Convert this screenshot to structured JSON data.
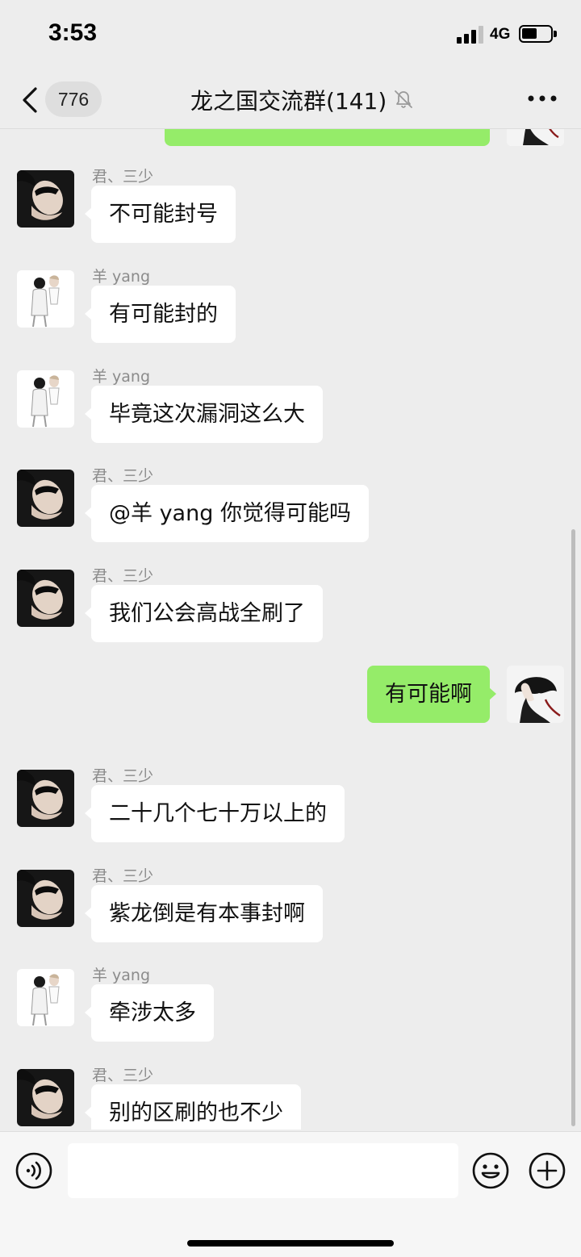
{
  "status_bar": {
    "time": "3:53",
    "network": "4G",
    "signal_bars_active": 3,
    "signal_bars_total": 4,
    "battery_level": 0.55
  },
  "nav": {
    "unread_count": "776",
    "title": "龙之国交流群(141)",
    "muted": true,
    "back_icon": "chevron-left-icon",
    "mute_icon": "bell-off-icon",
    "more_icon": "ellipsis-icon"
  },
  "messages": [
    {
      "sender": "君、三少",
      "text": "不可能封号",
      "direction": "incoming",
      "avatar": "avatar-junsanshao"
    },
    {
      "sender": "羊 yang",
      "text": "有可能封的",
      "direction": "incoming",
      "avatar": "avatar-yang"
    },
    {
      "sender": "羊 yang",
      "text": "毕竟这次漏洞这么大",
      "direction": "incoming",
      "avatar": "avatar-yang"
    },
    {
      "sender": "君、三少",
      "text": "@羊 yang 你觉得可能吗",
      "direction": "incoming",
      "avatar": "avatar-junsanshao"
    },
    {
      "sender": "君、三少",
      "text": "我们公会高战全刷了",
      "direction": "incoming",
      "avatar": "avatar-junsanshao"
    },
    {
      "sender": "",
      "text": "有可能啊",
      "direction": "outgoing",
      "avatar": "avatar-self"
    },
    {
      "sender": "君、三少",
      "text": "二十几个七十万以上的",
      "direction": "incoming",
      "avatar": "avatar-junsanshao"
    },
    {
      "sender": "君、三少",
      "text": "紫龙倒是有本事封啊",
      "direction": "incoming",
      "avatar": "avatar-junsanshao"
    },
    {
      "sender": "羊 yang",
      "text": "牵涉太多",
      "direction": "incoming",
      "avatar": "avatar-yang"
    },
    {
      "sender": "君、三少",
      "text": "别的区刷的也不少",
      "direction": "incoming",
      "avatar": "avatar-junsanshao"
    }
  ],
  "input_bar": {
    "placeholder": "",
    "voice_icon": "voice-icon",
    "emoji_icon": "emoji-icon",
    "plus_icon": "plus-circle-icon"
  },
  "colors": {
    "background": "#ededed",
    "bubble_incoming": "#ffffff",
    "bubble_outgoing": "#95ec69",
    "sender_name": "#8b8b8b"
  }
}
